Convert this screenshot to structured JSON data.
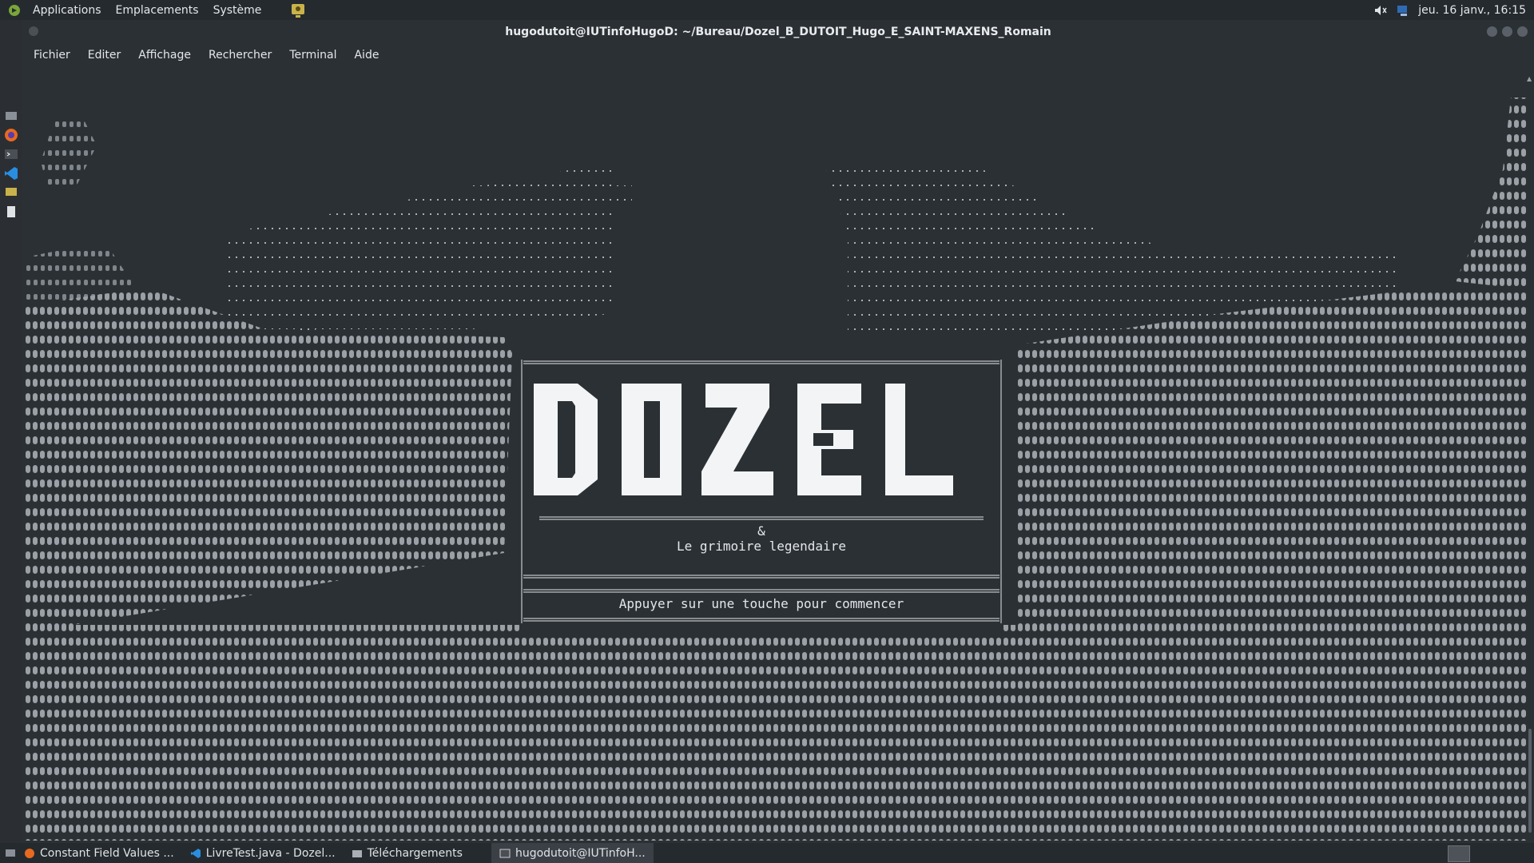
{
  "top_panel": {
    "menus": [
      "Applications",
      "Emplacements",
      "Système"
    ],
    "clock": "jeu. 16 janv., 16:15"
  },
  "window": {
    "title": "hugodutoit@IUTinfoHugoD: ~/Bureau/Dozel_B_DUTOIT_Hugo_E_SAINT-MAXENS_Romain",
    "menus": [
      "Fichier",
      "Editer",
      "Affichage",
      "Rechercher",
      "Terminal",
      "Aide"
    ]
  },
  "splash": {
    "logo": "DOZEL",
    "ampersand": "&",
    "subtitle": "Le grimoire legendaire",
    "prompt": "Appuyer sur une touche pour commencer"
  },
  "taskbar": {
    "items": [
      "Constant Field Values ...",
      "LivreTest.java - Dozel...",
      "Téléchargements",
      "hugodutoit@IUTinfoH..."
    ]
  },
  "colors": {
    "background": "#2b3034",
    "text": "#e4e7ea",
    "panel": "#252a2e"
  }
}
